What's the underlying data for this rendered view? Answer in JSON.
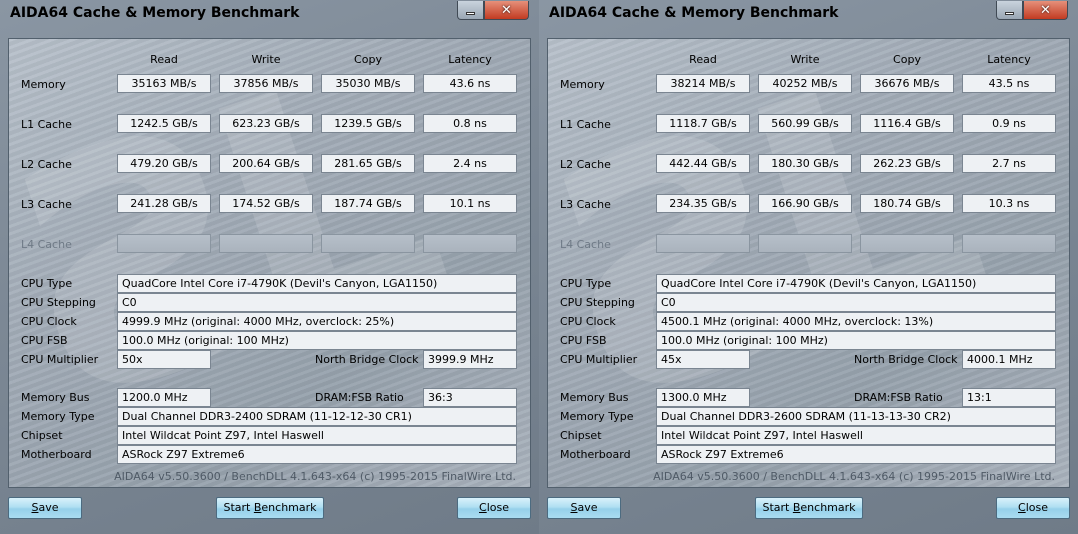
{
  "windows": [
    {
      "title": "AIDA64 Cache & Memory Benchmark",
      "columns": [
        "Read",
        "Write",
        "Copy",
        "Latency"
      ],
      "rows": [
        {
          "label": "Memory",
          "read": "35163 MB/s",
          "write": "37856 MB/s",
          "copy": "35030 MB/s",
          "latency": "43.6 ns"
        },
        {
          "label": "L1 Cache",
          "read": "1242.5 GB/s",
          "write": "623.23 GB/s",
          "copy": "1239.5 GB/s",
          "latency": "0.8 ns"
        },
        {
          "label": "L2 Cache",
          "read": "479.20 GB/s",
          "write": "200.64 GB/s",
          "copy": "281.65 GB/s",
          "latency": "2.4 ns"
        },
        {
          "label": "L3 Cache",
          "read": "241.28 GB/s",
          "write": "174.52 GB/s",
          "copy": "187.74 GB/s",
          "latency": "10.1 ns"
        },
        {
          "label": "L4 Cache",
          "read": "",
          "write": "",
          "copy": "",
          "latency": ""
        }
      ],
      "info": {
        "cpu_type_label": "CPU Type",
        "cpu_type": "QuadCore Intel Core i7-4790K  (Devil's Canyon, LGA1150)",
        "cpu_stepping_label": "CPU Stepping",
        "cpu_stepping": "C0",
        "cpu_clock_label": "CPU Clock",
        "cpu_clock": "4999.9 MHz  (original: 4000 MHz, overclock: 25%)",
        "cpu_fsb_label": "CPU FSB",
        "cpu_fsb": "100.0 MHz  (original: 100 MHz)",
        "cpu_multiplier_label": "CPU Multiplier",
        "cpu_multiplier": "50x",
        "north_bridge_label": "North Bridge Clock",
        "north_bridge": "3999.9 MHz",
        "memory_bus_label": "Memory Bus",
        "memory_bus": "1200.0 MHz",
        "dram_fsb_label": "DRAM:FSB Ratio",
        "dram_fsb": "36:3",
        "memory_type_label": "Memory Type",
        "memory_type": "Dual Channel DDR3-2400 SDRAM  (11-12-12-30 CR1)",
        "chipset_label": "Chipset",
        "chipset": "Intel Wildcat Point Z97, Intel Haswell",
        "motherboard_label": "Motherboard",
        "motherboard": "ASRock Z97 Extreme6"
      },
      "copyright": "AIDA64 v5.50.3600 / BenchDLL 4.1.643-x64  (c) 1995-2015 FinalWire Ltd.",
      "buttons": {
        "save_pre": "",
        "save_ul": "S",
        "save_post": "ave",
        "start_pre": "Start ",
        "start_ul": "B",
        "start_post": "enchmark",
        "close_pre": "",
        "close_ul": "C",
        "close_post": "lose"
      }
    },
    {
      "title": "AIDA64 Cache & Memory Benchmark",
      "columns": [
        "Read",
        "Write",
        "Copy",
        "Latency"
      ],
      "rows": [
        {
          "label": "Memory",
          "read": "38214 MB/s",
          "write": "40252 MB/s",
          "copy": "36676 MB/s",
          "latency": "43.5 ns"
        },
        {
          "label": "L1 Cache",
          "read": "1118.7 GB/s",
          "write": "560.99 GB/s",
          "copy": "1116.4 GB/s",
          "latency": "0.9 ns"
        },
        {
          "label": "L2 Cache",
          "read": "442.44 GB/s",
          "write": "180.30 GB/s",
          "copy": "262.23 GB/s",
          "latency": "2.7 ns"
        },
        {
          "label": "L3 Cache",
          "read": "234.35 GB/s",
          "write": "166.90 GB/s",
          "copy": "180.74 GB/s",
          "latency": "10.3 ns"
        },
        {
          "label": "L4 Cache",
          "read": "",
          "write": "",
          "copy": "",
          "latency": ""
        }
      ],
      "info": {
        "cpu_type_label": "CPU Type",
        "cpu_type": "QuadCore Intel Core i7-4790K  (Devil's Canyon, LGA1150)",
        "cpu_stepping_label": "CPU Stepping",
        "cpu_stepping": "C0",
        "cpu_clock_label": "CPU Clock",
        "cpu_clock": "4500.1 MHz  (original: 4000 MHz, overclock: 13%)",
        "cpu_fsb_label": "CPU FSB",
        "cpu_fsb": "100.0 MHz  (original: 100 MHz)",
        "cpu_multiplier_label": "CPU Multiplier",
        "cpu_multiplier": "45x",
        "north_bridge_label": "North Bridge Clock",
        "north_bridge": "4000.1 MHz",
        "memory_bus_label": "Memory Bus",
        "memory_bus": "1300.0 MHz",
        "dram_fsb_label": "DRAM:FSB Ratio",
        "dram_fsb": "13:1",
        "memory_type_label": "Memory Type",
        "memory_type": "Dual Channel DDR3-2600 SDRAM  (11-13-13-30 CR2)",
        "chipset_label": "Chipset",
        "chipset": "Intel Wildcat Point Z97, Intel Haswell",
        "motherboard_label": "Motherboard",
        "motherboard": "ASRock Z97 Extreme6"
      },
      "copyright": "AIDA64 v5.50.3600 / BenchDLL 4.1.643-x64  (c) 1995-2015 FinalWire Ltd.",
      "buttons": {
        "save_pre": "",
        "save_ul": "S",
        "save_post": "ave",
        "start_pre": "Start ",
        "start_ul": "B",
        "start_post": "enchmark",
        "close_pre": "",
        "close_ul": "C",
        "close_post": "lose"
      }
    }
  ]
}
